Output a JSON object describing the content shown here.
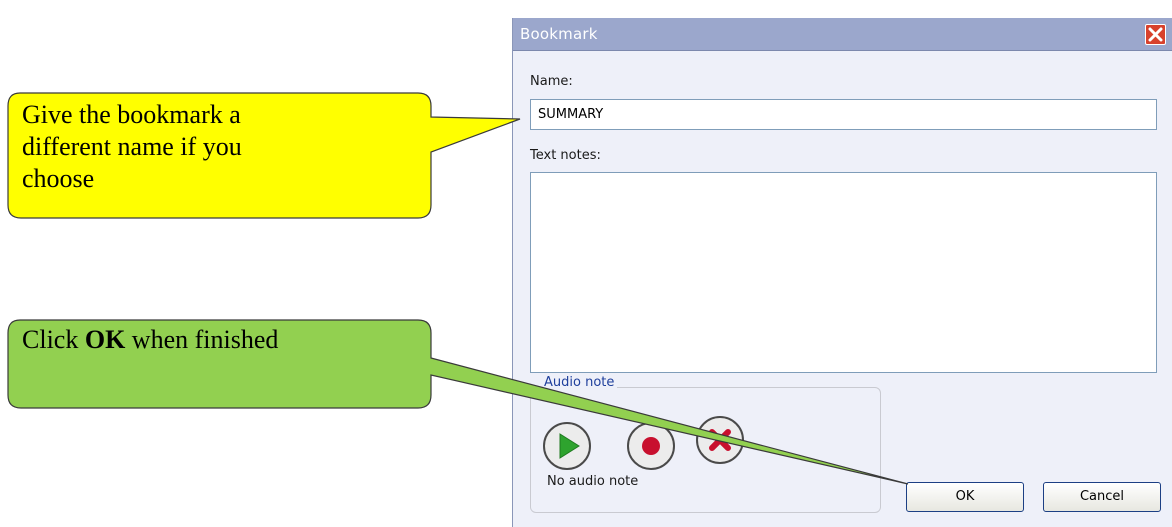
{
  "dialog": {
    "title": "Bookmark",
    "name_label": "Name:",
    "name_value": "SUMMARY",
    "notes_label": "Text notes:",
    "notes_value": "",
    "audio_group_label": "Audio note",
    "audio_status": "No audio note",
    "ok_label": "OK",
    "cancel_label": "Cancel",
    "audio_buttons": [
      "play-icon",
      "record-icon",
      "delete-icon"
    ]
  },
  "callouts": {
    "name_hint": {
      "lines": [
        "Give the bookmark a",
        "different name if you",
        "choose"
      ],
      "fill": "#ffff00"
    },
    "ok_hint": {
      "prefix": "Click ",
      "bold": "OK",
      "suffix": " when finished",
      "fill": "#92d050"
    }
  },
  "colors": {
    "titlebar": "#9ba7cc",
    "dialog_bg": "#eef0f9",
    "close_red": "#d8412c",
    "play_green": "#2ea32e",
    "record_red": "#c8102e"
  }
}
